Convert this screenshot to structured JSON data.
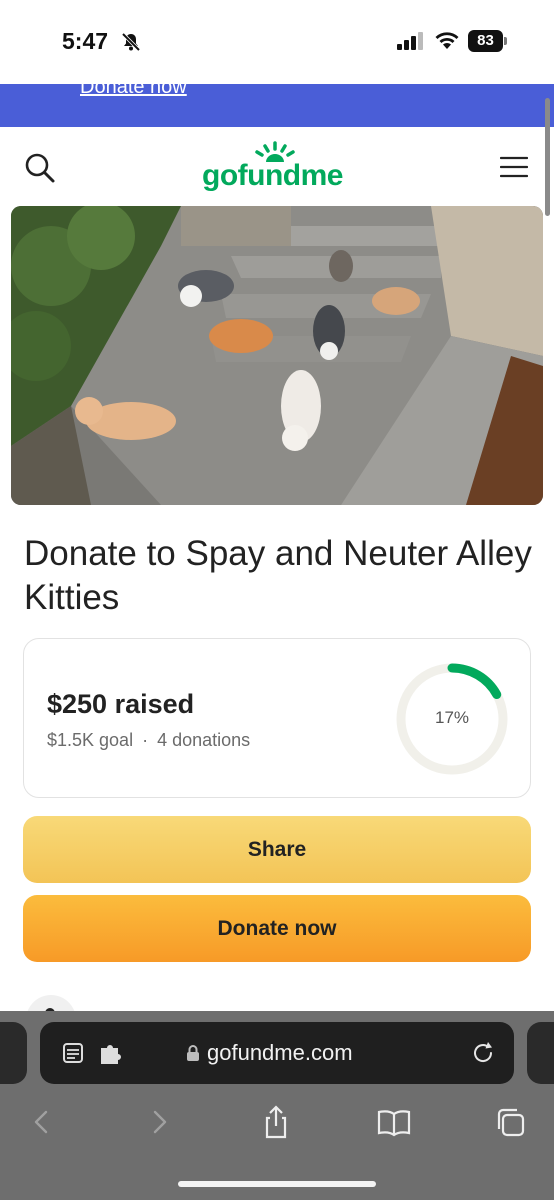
{
  "status_bar": {
    "time": "5:47",
    "battery": "83"
  },
  "banner": {
    "link_text": "Donate now"
  },
  "header": {
    "logo_text": "gofundme"
  },
  "campaign": {
    "title": "Donate to Spay and Neuter Alley Kitties",
    "raised": "$250 raised",
    "goal": "$1.5K goal",
    "separator": "·",
    "donations": "4 donations",
    "progress_label": "17%",
    "progress_fraction": 0.17
  },
  "actions": {
    "share_label": "Share",
    "donate_label": "Donate now"
  },
  "browser": {
    "url": "gofundme.com"
  },
  "colors": {
    "brand_green": "#02a95c",
    "banner_blue": "#4a5ed7",
    "share_yellow": "#f6cf67",
    "donate_orange": "#f9a630"
  }
}
